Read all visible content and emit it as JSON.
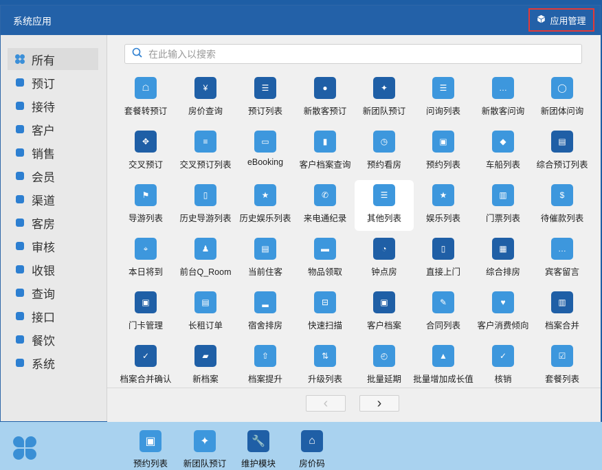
{
  "window": {
    "title": "系统应用",
    "manage_label": "应用管理"
  },
  "search": {
    "placeholder": "在此输入以搜索"
  },
  "sidebar": {
    "items": [
      {
        "label": "所有",
        "icon": "grid-icon",
        "color": "#3b8fd8"
      },
      {
        "label": "预订",
        "icon": "user-circle-icon",
        "color": "#2d7fd1"
      },
      {
        "label": "接待",
        "icon": "chat-icon",
        "color": "#2d7fd1"
      },
      {
        "label": "客户",
        "icon": "person-icon",
        "color": "#2d7fd1"
      },
      {
        "label": "销售",
        "icon": "pie-chart-icon",
        "color": "#2d7fd1"
      },
      {
        "label": "会员",
        "icon": "diamond-icon",
        "color": "#2d7fd1"
      },
      {
        "label": "渠道",
        "icon": "group-icon",
        "color": "#2d7fd1"
      },
      {
        "label": "客房",
        "icon": "bed-icon",
        "color": "#2d7fd1"
      },
      {
        "label": "审核",
        "icon": "stamp-icon",
        "color": "#2d7fd1"
      },
      {
        "label": "收银",
        "icon": "coins-icon",
        "color": "#2d7fd1"
      },
      {
        "label": "查询",
        "icon": "search-icon",
        "color": "#2d7fd1"
      },
      {
        "label": "接口",
        "icon": "plug-icon",
        "color": "#2d7fd1"
      },
      {
        "label": "餐饮",
        "icon": "utensils-icon",
        "color": "#2d7fd1"
      },
      {
        "label": "系统",
        "icon": "monitor-icon",
        "color": "#2d7fd1"
      }
    ]
  },
  "apps": [
    {
      "label": "套餐转预订",
      "icon": "package-transfer-icon",
      "color": "#3d97dd",
      "glyph": "☖"
    },
    {
      "label": "房价查询",
      "icon": "room-price-icon",
      "color": "#1f5fa6",
      "glyph": "¥"
    },
    {
      "label": "预订列表",
      "icon": "booking-list-icon",
      "color": "#1f5fa6",
      "glyph": "☰"
    },
    {
      "label": "新散客预订",
      "icon": "new-guest-booking-icon",
      "color": "#1f5fa6",
      "glyph": "●"
    },
    {
      "label": "新团队预订",
      "icon": "new-group-booking-icon",
      "color": "#1f5fa6",
      "glyph": "✦"
    },
    {
      "label": "问询列表",
      "icon": "inquiry-list-icon",
      "color": "#3d97dd",
      "glyph": "☰"
    },
    {
      "label": "新散客问询",
      "icon": "new-guest-inquiry-icon",
      "color": "#3d97dd",
      "glyph": "…"
    },
    {
      "label": "新团体问询",
      "icon": "new-group-inquiry-icon",
      "color": "#3d97dd",
      "glyph": "◯"
    },
    {
      "label": "交叉预订",
      "icon": "cross-booking-icon",
      "color": "#1f5fa6",
      "glyph": "✥"
    },
    {
      "label": "交叉预订列表",
      "icon": "cross-booking-list-icon",
      "color": "#3d97dd",
      "glyph": "≡"
    },
    {
      "label": "eBooking",
      "icon": "ebooking-icon",
      "color": "#3d97dd",
      "glyph": "▭"
    },
    {
      "label": "客户档案查询",
      "icon": "profile-query-icon",
      "color": "#3d97dd",
      "glyph": "▮"
    },
    {
      "label": "预约看房",
      "icon": "viewing-appointment-icon",
      "color": "#3d97dd",
      "glyph": "◷"
    },
    {
      "label": "预约列表",
      "icon": "appointment-list-icon",
      "color": "#3d97dd",
      "glyph": "▣"
    },
    {
      "label": "车船列表",
      "icon": "vehicle-list-icon",
      "color": "#3d97dd",
      "glyph": "◆"
    },
    {
      "label": "综合预订列表",
      "icon": "combined-booking-icon",
      "color": "#1f5fa6",
      "glyph": "▤"
    },
    {
      "label": "导游列表",
      "icon": "guide-list-icon",
      "color": "#3d97dd",
      "glyph": "⚑"
    },
    {
      "label": "历史导游列表",
      "icon": "guide-history-icon",
      "color": "#3d97dd",
      "glyph": "▯"
    },
    {
      "label": "历史娱乐列表",
      "icon": "entertainment-history-icon",
      "color": "#3d97dd",
      "glyph": "★"
    },
    {
      "label": "来电通纪录",
      "icon": "call-record-icon",
      "color": "#3d97dd",
      "glyph": "✆"
    },
    {
      "label": "其他列表",
      "icon": "other-list-icon",
      "color": "#3d97dd",
      "glyph": "☰"
    },
    {
      "label": "娱乐列表",
      "icon": "entertainment-list-icon",
      "color": "#3d97dd",
      "glyph": "★"
    },
    {
      "label": "门票列表",
      "icon": "ticket-list-icon",
      "color": "#3d97dd",
      "glyph": "▥"
    },
    {
      "label": "待催款列表",
      "icon": "dunning-list-icon",
      "color": "#3d97dd",
      "glyph": "$"
    },
    {
      "label": "本日将到",
      "icon": "arriving-today-icon",
      "color": "#3d97dd",
      "glyph": "⌖"
    },
    {
      "label": "前台Q_Room",
      "icon": "front-desk-qroom-icon",
      "color": "#3d97dd",
      "glyph": "♟"
    },
    {
      "label": "当前住客",
      "icon": "current-guests-icon",
      "color": "#3d97dd",
      "glyph": "▤"
    },
    {
      "label": "物品领取",
      "icon": "item-pickup-icon",
      "color": "#3d97dd",
      "glyph": "▬"
    },
    {
      "label": "钟点房",
      "icon": "hourly-room-icon",
      "color": "#1f5fa6",
      "glyph": "◔"
    },
    {
      "label": "直接上门",
      "icon": "walk-in-icon",
      "color": "#1f5fa6",
      "glyph": "▯"
    },
    {
      "label": "综合排房",
      "icon": "room-assign-icon",
      "color": "#1f5fa6",
      "glyph": "▦"
    },
    {
      "label": "宾客留言",
      "icon": "guest-message-icon",
      "color": "#3d97dd",
      "glyph": "…"
    },
    {
      "label": "门卡管理",
      "icon": "door-card-icon",
      "color": "#1f5fa6",
      "glyph": "▣"
    },
    {
      "label": "长租订单",
      "icon": "long-stay-icon",
      "color": "#3d97dd",
      "glyph": "▤"
    },
    {
      "label": "宿舍排房",
      "icon": "dorm-assign-icon",
      "color": "#3d97dd",
      "glyph": "▂"
    },
    {
      "label": "快速扫描",
      "icon": "quick-scan-icon",
      "color": "#3d97dd",
      "glyph": "⊟"
    },
    {
      "label": "客户档案",
      "icon": "customer-profile-icon",
      "color": "#1f5fa6",
      "glyph": "▣"
    },
    {
      "label": "合同列表",
      "icon": "contract-list-icon",
      "color": "#3d97dd",
      "glyph": "✎"
    },
    {
      "label": "客户消费倾向",
      "icon": "consumption-trend-icon",
      "color": "#3d97dd",
      "glyph": "♥"
    },
    {
      "label": "档案合并",
      "icon": "profile-merge-icon",
      "color": "#1f5fa6",
      "glyph": "▥"
    },
    {
      "label": "档案合并确认",
      "icon": "merge-confirm-icon",
      "color": "#1f5fa6",
      "glyph": "✓"
    },
    {
      "label": "新档案",
      "icon": "new-profile-icon",
      "color": "#1f5fa6",
      "glyph": "▰"
    },
    {
      "label": "档案提升",
      "icon": "profile-upgrade-icon",
      "color": "#3d97dd",
      "glyph": "⇧"
    },
    {
      "label": "升级列表",
      "icon": "upgrade-list-icon",
      "color": "#3d97dd",
      "glyph": "⇅"
    },
    {
      "label": "批量延期",
      "icon": "batch-extend-icon",
      "color": "#3d97dd",
      "glyph": "◴"
    },
    {
      "label": "批量增加成长值",
      "icon": "batch-growth-icon",
      "color": "#3d97dd",
      "glyph": "▲"
    },
    {
      "label": "核销",
      "icon": "write-off-icon",
      "color": "#3d97dd",
      "glyph": "✓"
    },
    {
      "label": "套餐列表",
      "icon": "package-list-icon",
      "color": "#3d97dd",
      "glyph": "☑"
    }
  ],
  "active_app_index": 20,
  "pager": {
    "prev_glyph": "‹",
    "next_glyph": "›"
  },
  "dock": [
    {
      "label": "预约列表",
      "icon": "appointment-list-icon",
      "color": "#3d97dd",
      "glyph": "▣"
    },
    {
      "label": "新团队预订",
      "icon": "new-group-booking-icon",
      "color": "#3d97dd",
      "glyph": "✦"
    },
    {
      "label": "维护模块",
      "icon": "wrench-icon",
      "color": "#1f5fa6",
      "glyph": "🔧"
    },
    {
      "label": "房价码",
      "icon": "home-icon",
      "color": "#1f5fa6",
      "glyph": "⌂"
    }
  ],
  "colors": {
    "titlebar": "#2361a8",
    "accent": "#2d7fd1",
    "highlight_border": "#e53935"
  }
}
